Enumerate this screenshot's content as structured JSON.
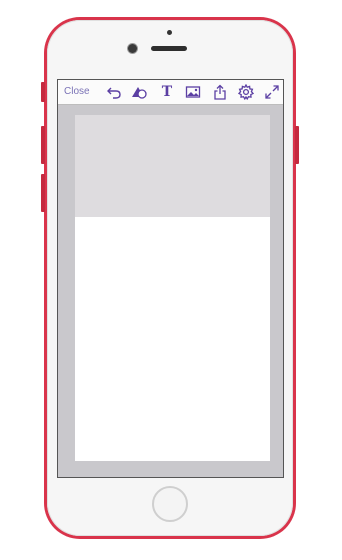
{
  "device": {
    "frame_color": "#d9344b"
  },
  "toolbar": {
    "close_label": "Close",
    "accent_color": "#5b3fa3",
    "icons": [
      "undo-icon",
      "shapes-icon",
      "text-icon",
      "image-icon",
      "share-icon",
      "settings-icon",
      "fullscreen-icon"
    ],
    "text_glyph": "T"
  },
  "canvas": {
    "background": "#c9c8cc",
    "page_background": "#ffffff",
    "page_header_background": "#dedcdf"
  }
}
